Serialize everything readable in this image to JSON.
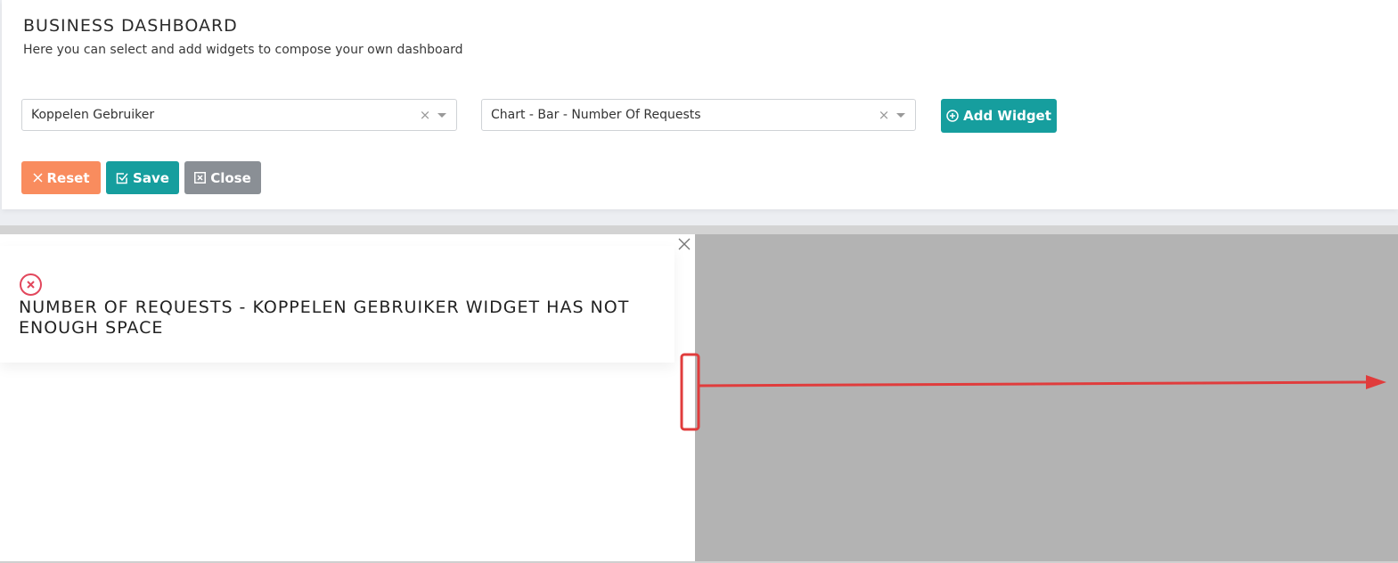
{
  "header": {
    "title": "BUSINESS DASHBOARD",
    "subtitle": "Here you can select and add widgets to compose your own dashboard"
  },
  "filters": {
    "source_select": {
      "value": "Koppelen Gebruiker",
      "clear_icon": "clear-icon",
      "dropdown_icon": "chevron-down-icon"
    },
    "widget_select": {
      "value": "Chart - Bar - Number Of Requests",
      "clear_icon": "clear-icon",
      "dropdown_icon": "chevron-down-icon"
    }
  },
  "buttons": {
    "add_widget": {
      "label": "Add Widget",
      "icon": "plus-circle-icon",
      "color": "#169e9e"
    },
    "reset": {
      "label": "Reset",
      "icon": "x-icon",
      "color": "#f98c5e"
    },
    "save": {
      "label": "Save",
      "icon": "checkbox-icon",
      "color": "#169e9e"
    },
    "close": {
      "label": "Close",
      "icon": "x-square-icon",
      "color": "#8a8f95"
    }
  },
  "widget": {
    "close_icon": "close-icon",
    "error_icon": "error-circle-icon",
    "error_color": "#e2475c",
    "error_message": "NUMBER OF REQUESTS - KOPPELEN GEBRUIKER WIDGET HAS NOT ENOUGH SPACE"
  },
  "annotation": {
    "color": "#e03c3c",
    "type": "resize-arrow"
  }
}
